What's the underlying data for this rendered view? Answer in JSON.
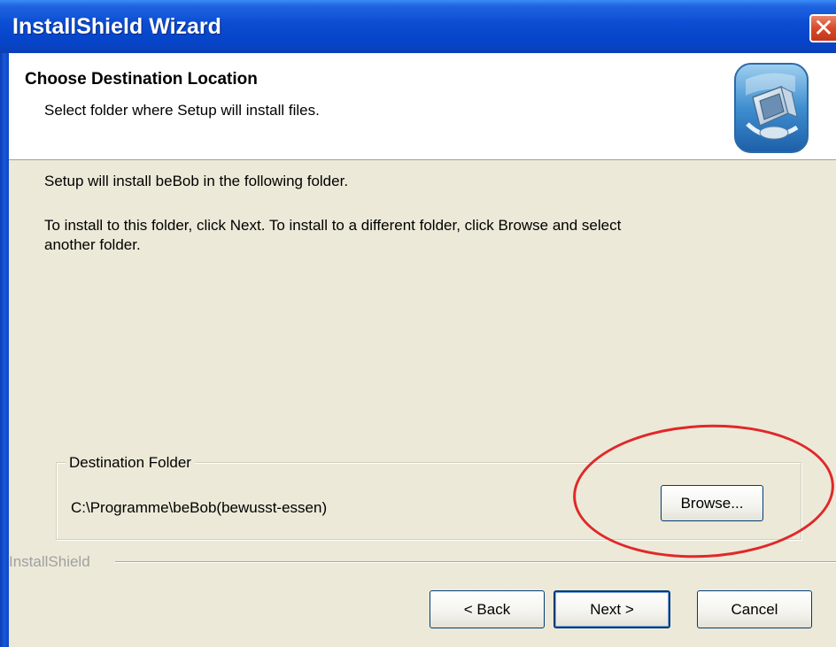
{
  "window": {
    "title": "InstallShield Wizard",
    "close_icon": "close-icon",
    "title_color": "#0a4cd2",
    "close_color": "#d7492a"
  },
  "header": {
    "title": "Choose Destination Location",
    "subtitle": "Select folder where Setup will install files.",
    "icon": "installer-computer-icon"
  },
  "content": {
    "line1": "Setup will install beBob in the following folder.",
    "line2a": "To install to this folder, click Next. To install to a different folder, click Browse and select",
    "line2b": "another folder."
  },
  "destination": {
    "group_label": "Destination Folder",
    "path": "C:\\Programme\\beBob(bewusst-essen)",
    "browse_label": "Browse..."
  },
  "footer": {
    "brand": "InstallShield",
    "back_label": "< Back",
    "next_label": "Next >",
    "cancel_label": "Cancel"
  },
  "annotation": {
    "shape": "ellipse",
    "color": "#e0282a",
    "target": "browse-button"
  }
}
